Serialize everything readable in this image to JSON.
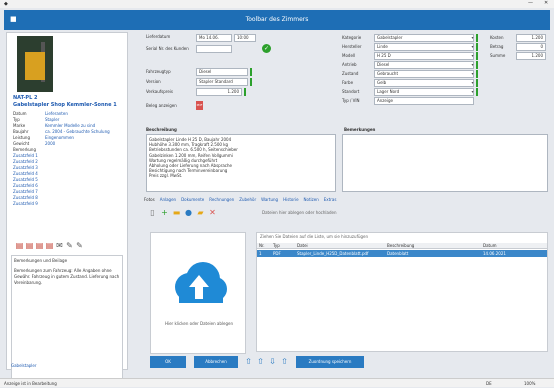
{
  "window": {
    "title": "Toolbar des Zimmers"
  },
  "left_panel": {
    "id_line": "NAT-PL 2",
    "name_line": "Gabelstapler Shop Kemmler-Sonne 1",
    "details": [
      {
        "k": "Datum",
        "v": "Lieferanten"
      },
      {
        "k": "Typ",
        "v": "Stapler"
      },
      {
        "k": "Marke",
        "v": "Kemmler Modelle zu sind"
      },
      {
        "k": "Baujahr",
        "v": "ca. 2004 - Gebrauchte Schulung"
      },
      {
        "k": "Leistung",
        "v": "Eingenommen"
      },
      {
        "k": "Gewicht",
        "v": "2000"
      },
      {
        "k": "Bemerkung",
        "v": ""
      }
    ],
    "extras": [
      "Zusatzfeld 1",
      "Zusatzfeld 2",
      "Zusatzfeld 3",
      "Zusatzfeld 4",
      "Zusatzfeld 5",
      "Zusatzfeld 6",
      "Zusatzfeld 7",
      "Zusatzfeld 8",
      "Zusatzfeld 9"
    ],
    "notes_title": "Bemerkungen und Beilage",
    "notes": "Bemerkungen zum Fahrzeug: Alle Angaben ohne Gewähr. Fahrzeug in gutem Zustand. Lieferung nach Vereinbarung.",
    "footer_link": "Gabelstapler"
  },
  "form": {
    "serial_label": "Serial Nr. des Kunden",
    "serial_value": "",
    "delivery_label": "Lieferdatum",
    "delivery_value": "Mo 14.06.",
    "time_value": "10:00",
    "type_label": "Fahrzeugtyp",
    "type_value": "Diesel",
    "version_label": "Version",
    "version_value": "Stapler Standard Version",
    "price_label": "Verkaufspreis",
    "price_value": "1.200",
    "doc_link": "Beleg anzeigen",
    "right_labels": [
      "Kategorie",
      "Hersteller",
      "Modell",
      "Antrieb",
      "Zustand",
      "Farbe",
      "Standort",
      "Typ / VIN"
    ],
    "right_values": [
      "Gabelstapler",
      "Linde",
      "H 25 D",
      "Diesel",
      "Gebraucht",
      "Gelb",
      "Lager Nord",
      "Anzeige"
    ],
    "far_labels": [
      "Kosten",
      "Betrag",
      "Summe"
    ],
    "far_values": [
      "1.200",
      "0",
      "1.200"
    ]
  },
  "description": {
    "title": "Beschreibung",
    "lines": [
      "Gabelstapler Linde H 25 D, Baujahr 2004",
      "Hubhöhe 3.300 mm, Tragkraft 2.500 kg",
      "Betriebsstunden ca. 6.500 h, Seitenschieber",
      "Gabelzinken 1.200 mm, Reifen Vollgummi",
      "Wartung regelmäßig durchgeführt",
      "Abholung oder Lieferung nach Absprache",
      "Besichtigung nach Terminvereinbarung",
      "Preis zzgl. MwSt."
    ],
    "remarks_title": "Bemerkungen"
  },
  "tabs": [
    "Fotos",
    "Anlagen",
    "Dokumente",
    "Rechnungen",
    "Zubehör",
    "Wartung",
    "Historie",
    "Notizen",
    "Extras"
  ],
  "upload": {
    "caption": "Hier klicken oder Dateien ablegen",
    "hint": "Dateien hier ablegen oder hochladen"
  },
  "grid": {
    "info": "Ziehen Sie Dateien auf die Liste, um sie hinzuzufügen",
    "headers": [
      "Nr.",
      "Typ",
      "Datei",
      "Beschreibung",
      "Datum"
    ],
    "rows": [
      {
        "nr": "1",
        "typ": "PDF",
        "file": "Stapler_Linde_H25D_Datenblatt.pdf",
        "desc": "Datenblatt",
        "date": "14.06.2021"
      }
    ]
  },
  "buttons": {
    "ok": "OK",
    "cancel": "Abbrechen",
    "assign": "Zuordnung speichern"
  },
  "status": {
    "left": "Anzeige ist in Bearbeitung",
    "right1": "DE",
    "right2": "100%"
  },
  "colors": {
    "accent": "#1e6eb5",
    "valid": "#2ca02c",
    "selection": "#3b87c9"
  }
}
